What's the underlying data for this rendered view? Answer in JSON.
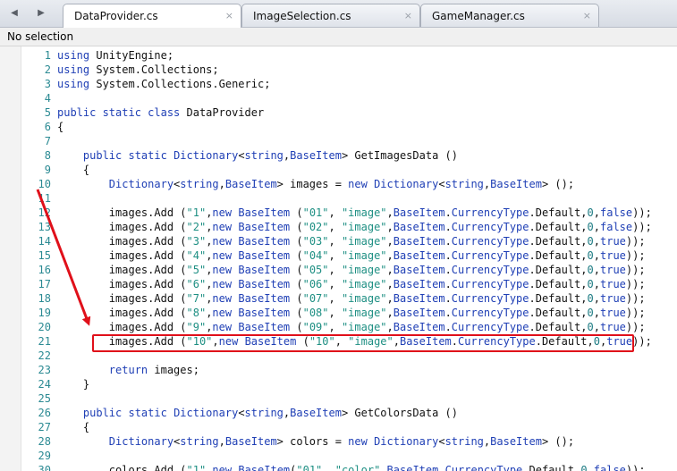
{
  "tabs": [
    {
      "label": "DataProvider.cs",
      "close": "×"
    },
    {
      "label": "ImageSelection.cs",
      "close": "×"
    },
    {
      "label": "GameManager.cs",
      "close": "×"
    }
  ],
  "nav": {
    "back": "◀",
    "forward": "▶"
  },
  "status": "No selection",
  "annotation_color": "#e0101a",
  "lines": [
    {
      "n": "1",
      "t": [
        [
          "kw",
          "using"
        ],
        [
          "p",
          " UnityEngine;"
        ]
      ]
    },
    {
      "n": "2",
      "t": [
        [
          "kw",
          "using"
        ],
        [
          "p",
          " System.Collections;"
        ]
      ]
    },
    {
      "n": "3",
      "t": [
        [
          "kw",
          "using"
        ],
        [
          "p",
          " System.Collections.Generic;"
        ]
      ]
    },
    {
      "n": "4",
      "t": []
    },
    {
      "n": "5",
      "t": [
        [
          "kw",
          "public static class"
        ],
        [
          "p",
          " DataProvider"
        ]
      ]
    },
    {
      "n": "6",
      "t": [
        [
          "p",
          "{"
        ]
      ]
    },
    {
      "n": "7",
      "t": []
    },
    {
      "n": "8",
      "t": [
        [
          "p",
          "    "
        ],
        [
          "kw",
          "public static"
        ],
        [
          "p",
          " "
        ],
        [
          "kw",
          "Dictionary"
        ],
        [
          "p",
          "<"
        ],
        [
          "kw",
          "string"
        ],
        [
          "p",
          ","
        ],
        [
          "kw",
          "BaseItem"
        ],
        [
          "p",
          "> GetImagesData ()"
        ]
      ]
    },
    {
      "n": "9",
      "t": [
        [
          "p",
          "    {"
        ]
      ]
    },
    {
      "n": "10",
      "t": [
        [
          "p",
          "        "
        ],
        [
          "kw",
          "Dictionary"
        ],
        [
          "p",
          "<"
        ],
        [
          "kw",
          "string"
        ],
        [
          "p",
          ","
        ],
        [
          "kw",
          "BaseItem"
        ],
        [
          "p",
          "> images = "
        ],
        [
          "kw",
          "new"
        ],
        [
          "p",
          " "
        ],
        [
          "kw",
          "Dictionary"
        ],
        [
          "p",
          "<"
        ],
        [
          "kw",
          "string"
        ],
        [
          "p",
          ","
        ],
        [
          "kw",
          "BaseItem"
        ],
        [
          "p",
          "> ();"
        ]
      ]
    },
    {
      "n": "11",
      "t": []
    },
    {
      "n": "12",
      "t": [
        [
          "p",
          "        images.Add ("
        ],
        [
          "str",
          "\"1\""
        ],
        [
          "p",
          ","
        ],
        [
          "kw",
          "new"
        ],
        [
          "p",
          " "
        ],
        [
          "kw",
          "BaseItem"
        ],
        [
          "p",
          " ("
        ],
        [
          "str",
          "\"01\""
        ],
        [
          "p",
          ", "
        ],
        [
          "str",
          "\"image\""
        ],
        [
          "p",
          ","
        ],
        [
          "kw",
          "BaseItem"
        ],
        [
          "p",
          "."
        ],
        [
          "kw",
          "CurrencyType"
        ],
        [
          "p",
          ".Default,"
        ],
        [
          "num",
          "0"
        ],
        [
          "p",
          ","
        ],
        [
          "kw",
          "false"
        ],
        [
          "p",
          "));"
        ]
      ]
    },
    {
      "n": "13",
      "t": [
        [
          "p",
          "        images.Add ("
        ],
        [
          "str",
          "\"2\""
        ],
        [
          "p",
          ","
        ],
        [
          "kw",
          "new"
        ],
        [
          "p",
          " "
        ],
        [
          "kw",
          "BaseItem"
        ],
        [
          "p",
          " ("
        ],
        [
          "str",
          "\"02\""
        ],
        [
          "p",
          ", "
        ],
        [
          "str",
          "\"image\""
        ],
        [
          "p",
          ","
        ],
        [
          "kw",
          "BaseItem"
        ],
        [
          "p",
          "."
        ],
        [
          "kw",
          "CurrencyType"
        ],
        [
          "p",
          ".Default,"
        ],
        [
          "num",
          "0"
        ],
        [
          "p",
          ","
        ],
        [
          "kw",
          "false"
        ],
        [
          "p",
          "));"
        ]
      ]
    },
    {
      "n": "14",
      "t": [
        [
          "p",
          "        images.Add ("
        ],
        [
          "str",
          "\"3\""
        ],
        [
          "p",
          ","
        ],
        [
          "kw",
          "new"
        ],
        [
          "p",
          " "
        ],
        [
          "kw",
          "BaseItem"
        ],
        [
          "p",
          " ("
        ],
        [
          "str",
          "\"03\""
        ],
        [
          "p",
          ", "
        ],
        [
          "str",
          "\"image\""
        ],
        [
          "p",
          ","
        ],
        [
          "kw",
          "BaseItem"
        ],
        [
          "p",
          "."
        ],
        [
          "kw",
          "CurrencyType"
        ],
        [
          "p",
          ".Default,"
        ],
        [
          "num",
          "0"
        ],
        [
          "p",
          ","
        ],
        [
          "kw",
          "true"
        ],
        [
          "p",
          "));"
        ]
      ]
    },
    {
      "n": "15",
      "t": [
        [
          "p",
          "        images.Add ("
        ],
        [
          "str",
          "\"4\""
        ],
        [
          "p",
          ","
        ],
        [
          "kw",
          "new"
        ],
        [
          "p",
          " "
        ],
        [
          "kw",
          "BaseItem"
        ],
        [
          "p",
          " ("
        ],
        [
          "str",
          "\"04\""
        ],
        [
          "p",
          ", "
        ],
        [
          "str",
          "\"image\""
        ],
        [
          "p",
          ","
        ],
        [
          "kw",
          "BaseItem"
        ],
        [
          "p",
          "."
        ],
        [
          "kw",
          "CurrencyType"
        ],
        [
          "p",
          ".Default,"
        ],
        [
          "num",
          "0"
        ],
        [
          "p",
          ","
        ],
        [
          "kw",
          "true"
        ],
        [
          "p",
          "));"
        ]
      ]
    },
    {
      "n": "16",
      "t": [
        [
          "p",
          "        images.Add ("
        ],
        [
          "str",
          "\"5\""
        ],
        [
          "p",
          ","
        ],
        [
          "kw",
          "new"
        ],
        [
          "p",
          " "
        ],
        [
          "kw",
          "BaseItem"
        ],
        [
          "p",
          " ("
        ],
        [
          "str",
          "\"05\""
        ],
        [
          "p",
          ", "
        ],
        [
          "str",
          "\"image\""
        ],
        [
          "p",
          ","
        ],
        [
          "kw",
          "BaseItem"
        ],
        [
          "p",
          "."
        ],
        [
          "kw",
          "CurrencyType"
        ],
        [
          "p",
          ".Default,"
        ],
        [
          "num",
          "0"
        ],
        [
          "p",
          ","
        ],
        [
          "kw",
          "true"
        ],
        [
          "p",
          "));"
        ]
      ]
    },
    {
      "n": "17",
      "t": [
        [
          "p",
          "        images.Add ("
        ],
        [
          "str",
          "\"6\""
        ],
        [
          "p",
          ","
        ],
        [
          "kw",
          "new"
        ],
        [
          "p",
          " "
        ],
        [
          "kw",
          "BaseItem"
        ],
        [
          "p",
          " ("
        ],
        [
          "str",
          "\"06\""
        ],
        [
          "p",
          ", "
        ],
        [
          "str",
          "\"image\""
        ],
        [
          "p",
          ","
        ],
        [
          "kw",
          "BaseItem"
        ],
        [
          "p",
          "."
        ],
        [
          "kw",
          "CurrencyType"
        ],
        [
          "p",
          ".Default,"
        ],
        [
          "num",
          "0"
        ],
        [
          "p",
          ","
        ],
        [
          "kw",
          "true"
        ],
        [
          "p",
          "));"
        ]
      ]
    },
    {
      "n": "18",
      "t": [
        [
          "p",
          "        images.Add ("
        ],
        [
          "str",
          "\"7\""
        ],
        [
          "p",
          ","
        ],
        [
          "kw",
          "new"
        ],
        [
          "p",
          " "
        ],
        [
          "kw",
          "BaseItem"
        ],
        [
          "p",
          " ("
        ],
        [
          "str",
          "\"07\""
        ],
        [
          "p",
          ", "
        ],
        [
          "str",
          "\"image\""
        ],
        [
          "p",
          ","
        ],
        [
          "kw",
          "BaseItem"
        ],
        [
          "p",
          "."
        ],
        [
          "kw",
          "CurrencyType"
        ],
        [
          "p",
          ".Default,"
        ],
        [
          "num",
          "0"
        ],
        [
          "p",
          ","
        ],
        [
          "kw",
          "true"
        ],
        [
          "p",
          "));"
        ]
      ]
    },
    {
      "n": "19",
      "t": [
        [
          "p",
          "        images.Add ("
        ],
        [
          "str",
          "\"8\""
        ],
        [
          "p",
          ","
        ],
        [
          "kw",
          "new"
        ],
        [
          "p",
          " "
        ],
        [
          "kw",
          "BaseItem"
        ],
        [
          "p",
          " ("
        ],
        [
          "str",
          "\"08\""
        ],
        [
          "p",
          ", "
        ],
        [
          "str",
          "\"image\""
        ],
        [
          "p",
          ","
        ],
        [
          "kw",
          "BaseItem"
        ],
        [
          "p",
          "."
        ],
        [
          "kw",
          "CurrencyType"
        ],
        [
          "p",
          ".Default,"
        ],
        [
          "num",
          "0"
        ],
        [
          "p",
          ","
        ],
        [
          "kw",
          "true"
        ],
        [
          "p",
          "));"
        ]
      ]
    },
    {
      "n": "20",
      "t": [
        [
          "p",
          "        images.Add ("
        ],
        [
          "str",
          "\"9\""
        ],
        [
          "p",
          ","
        ],
        [
          "kw",
          "new"
        ],
        [
          "p",
          " "
        ],
        [
          "kw",
          "BaseItem"
        ],
        [
          "p",
          " ("
        ],
        [
          "str",
          "\"09\""
        ],
        [
          "p",
          ", "
        ],
        [
          "str",
          "\"image\""
        ],
        [
          "p",
          ","
        ],
        [
          "kw",
          "BaseItem"
        ],
        [
          "p",
          "."
        ],
        [
          "kw",
          "CurrencyType"
        ],
        [
          "p",
          ".Default,"
        ],
        [
          "num",
          "0"
        ],
        [
          "p",
          ","
        ],
        [
          "kw",
          "true"
        ],
        [
          "p",
          "));"
        ]
      ]
    },
    {
      "n": "21",
      "t": [
        [
          "p",
          "        images.Add ("
        ],
        [
          "str",
          "\"10\""
        ],
        [
          "p",
          ","
        ],
        [
          "kw",
          "new"
        ],
        [
          "p",
          " "
        ],
        [
          "kw",
          "BaseItem"
        ],
        [
          "p",
          " ("
        ],
        [
          "str",
          "\"10\""
        ],
        [
          "p",
          ", "
        ],
        [
          "str",
          "\"image\""
        ],
        [
          "p",
          ","
        ],
        [
          "kw",
          "BaseItem"
        ],
        [
          "p",
          "."
        ],
        [
          "kw",
          "CurrencyType"
        ],
        [
          "p",
          ".Default,"
        ],
        [
          "num",
          "0"
        ],
        [
          "p",
          ","
        ],
        [
          "kw",
          "true"
        ],
        [
          "p",
          "));"
        ]
      ]
    },
    {
      "n": "22",
      "t": []
    },
    {
      "n": "23",
      "t": [
        [
          "p",
          "        "
        ],
        [
          "kw",
          "return"
        ],
        [
          "p",
          " images;"
        ]
      ]
    },
    {
      "n": "24",
      "t": [
        [
          "p",
          "    }"
        ]
      ]
    },
    {
      "n": "25",
      "t": []
    },
    {
      "n": "26",
      "t": [
        [
          "p",
          "    "
        ],
        [
          "kw",
          "public static"
        ],
        [
          "p",
          " "
        ],
        [
          "kw",
          "Dictionary"
        ],
        [
          "p",
          "<"
        ],
        [
          "kw",
          "string"
        ],
        [
          "p",
          ","
        ],
        [
          "kw",
          "BaseItem"
        ],
        [
          "p",
          "> GetColorsData ()"
        ]
      ]
    },
    {
      "n": "27",
      "t": [
        [
          "p",
          "    {"
        ]
      ]
    },
    {
      "n": "28",
      "t": [
        [
          "p",
          "        "
        ],
        [
          "kw",
          "Dictionary"
        ],
        [
          "p",
          "<"
        ],
        [
          "kw",
          "string"
        ],
        [
          "p",
          ","
        ],
        [
          "kw",
          "BaseItem"
        ],
        [
          "p",
          "> colors = "
        ],
        [
          "kw",
          "new"
        ],
        [
          "p",
          " "
        ],
        [
          "kw",
          "Dictionary"
        ],
        [
          "p",
          "<"
        ],
        [
          "kw",
          "string"
        ],
        [
          "p",
          ","
        ],
        [
          "kw",
          "BaseItem"
        ],
        [
          "p",
          "> ();"
        ]
      ]
    },
    {
      "n": "29",
      "t": []
    },
    {
      "n": "30",
      "t": [
        [
          "p",
          "        colors.Add ("
        ],
        [
          "str",
          "\"1\""
        ],
        [
          "p",
          ","
        ],
        [
          "kw",
          "new"
        ],
        [
          "p",
          " "
        ],
        [
          "kw",
          "BaseItem"
        ],
        [
          "p",
          "("
        ],
        [
          "str",
          "\"01\""
        ],
        [
          "p",
          ", "
        ],
        [
          "str",
          "\"color\""
        ],
        [
          "p",
          ","
        ],
        [
          "kw",
          "BaseItem"
        ],
        [
          "p",
          "."
        ],
        [
          "kw",
          "CurrencyType"
        ],
        [
          "p",
          ".Default,"
        ],
        [
          "num",
          "0"
        ],
        [
          "p",
          ","
        ],
        [
          "kw",
          "false"
        ],
        [
          "p",
          "));"
        ]
      ]
    }
  ]
}
